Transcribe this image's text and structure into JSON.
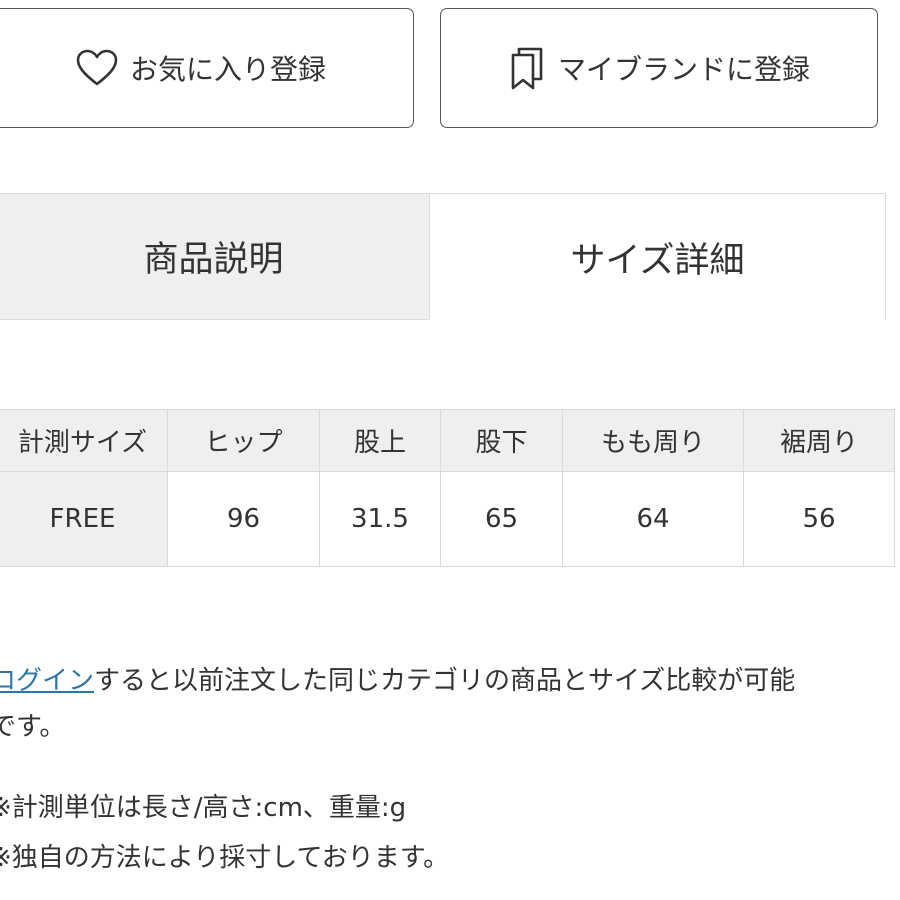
{
  "actions": {
    "favorite_label": "お気に入り登録",
    "mybrand_label": "マイブランドに登録"
  },
  "tabs": [
    {
      "label": "商品説明",
      "active": false
    },
    {
      "label": "サイズ詳細",
      "active": true
    }
  ],
  "size_table": {
    "headers": [
      "計測サイズ",
      "ヒップ",
      "股上",
      "股下",
      "もも周り",
      "裾周り"
    ],
    "rows": [
      [
        "FREE",
        "96",
        "31.5",
        "65",
        "64",
        "56"
      ]
    ]
  },
  "notes": {
    "login_link": "ログイン",
    "login_text_line1": "すると以前注文した同じカテゴリの商品とサイズ比較が可能",
    "login_text_line2": "です。",
    "unit_note": "※計測単位は長さ/高さ:cm、重量:g",
    "method_note": "※独自の方法により採寸しております。"
  },
  "colors": {
    "link": "#2b78a8",
    "tab_inactive_bg": "#efefef",
    "border": "#dadada"
  }
}
